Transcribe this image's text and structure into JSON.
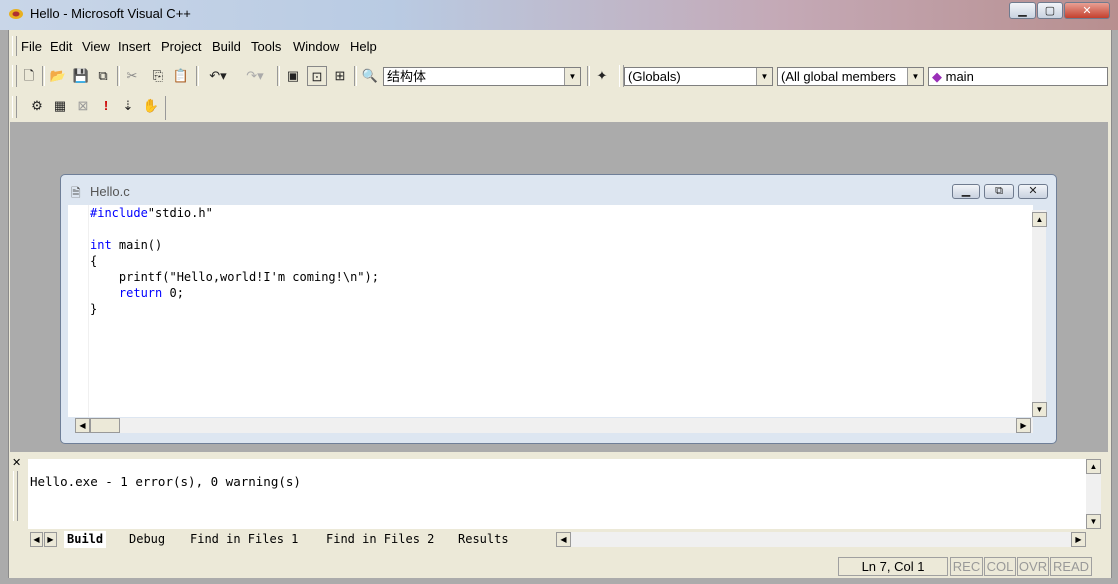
{
  "window": {
    "title": "Hello - Microsoft Visual C++"
  },
  "menu": [
    "File",
    "Edit",
    "View",
    "Insert",
    "Project",
    "Build",
    "Tools",
    "Window",
    "Help"
  ],
  "toolbar": {
    "font_combo": "结构体",
    "class_combo": "(Globals)",
    "members_combo": "(All global members",
    "function_combo": "main"
  },
  "editor": {
    "filename": "Hello.c",
    "lines": [
      "#include\"stdio.h\"",
      "",
      "int main()",
      "{",
      "    printf(\"Hello,world!I'm coming!\\n\");",
      "    return 0;",
      "}"
    ]
  },
  "output": {
    "text": "Hello.exe - 1 error(s), 0 warning(s)",
    "tabs": [
      "Build",
      "Debug",
      "Find in Files 1",
      "Find in Files 2",
      "Results"
    ]
  },
  "status": {
    "position": "Ln 7, Col 1",
    "indicators": [
      "REC",
      "COL",
      "OVR",
      "READ"
    ]
  },
  "colors": {
    "keyword": "#0000ff",
    "frame": "#ece9d8",
    "mdi_background": "#ababab"
  },
  "icons": [
    "vc-app-icon",
    "minimize-icon",
    "maximize-icon",
    "close-icon",
    "new-text-file-icon",
    "open-icon",
    "save-icon",
    "save-all-icon",
    "cut-icon",
    "copy-icon",
    "paste-icon",
    "undo-icon",
    "redo-icon",
    "workspace-icon",
    "output-icon",
    "window-list-icon",
    "find-in-files-icon",
    "wizardbar-icon",
    "compile-icon",
    "build-icon",
    "stop-build-icon",
    "execute-icon",
    "go-icon",
    "breakpoint-icon",
    "file-icon",
    "function-icon"
  ]
}
